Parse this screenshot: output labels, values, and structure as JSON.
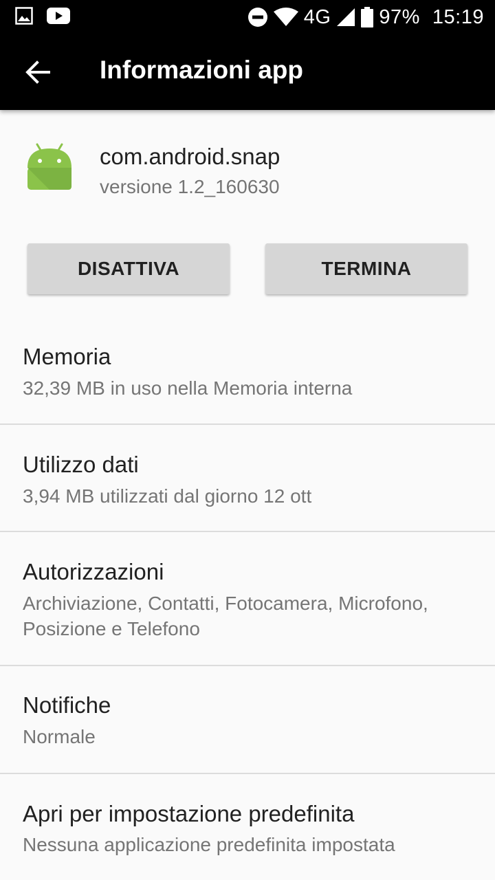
{
  "status_bar": {
    "network": "4G",
    "battery": "97%",
    "time": "15:19"
  },
  "app_bar": {
    "title": "Informazioni app"
  },
  "app": {
    "name": "com.android.snap",
    "version": "versione 1.2_160630"
  },
  "buttons": {
    "disable": "DISATTIVA",
    "stop": "TERMINA"
  },
  "items": [
    {
      "title": "Memoria",
      "subtitle": "32,39 MB in uso nella Memoria interna"
    },
    {
      "title": "Utilizzo dati",
      "subtitle": "3,94 MB utilizzati dal giorno 12 ott"
    },
    {
      "title": "Autorizzazioni",
      "subtitle": "Archiviazione, Contatti, Fotocamera, Microfono, Posizione e Telefono"
    },
    {
      "title": "Notifiche",
      "subtitle": "Normale"
    },
    {
      "title": "Apri per impostazione predefinita",
      "subtitle": "Nessuna applicazione predefinita impostata"
    }
  ],
  "colors": {
    "app_bar_bg": "#000000",
    "android_green": "#8BC34A"
  }
}
